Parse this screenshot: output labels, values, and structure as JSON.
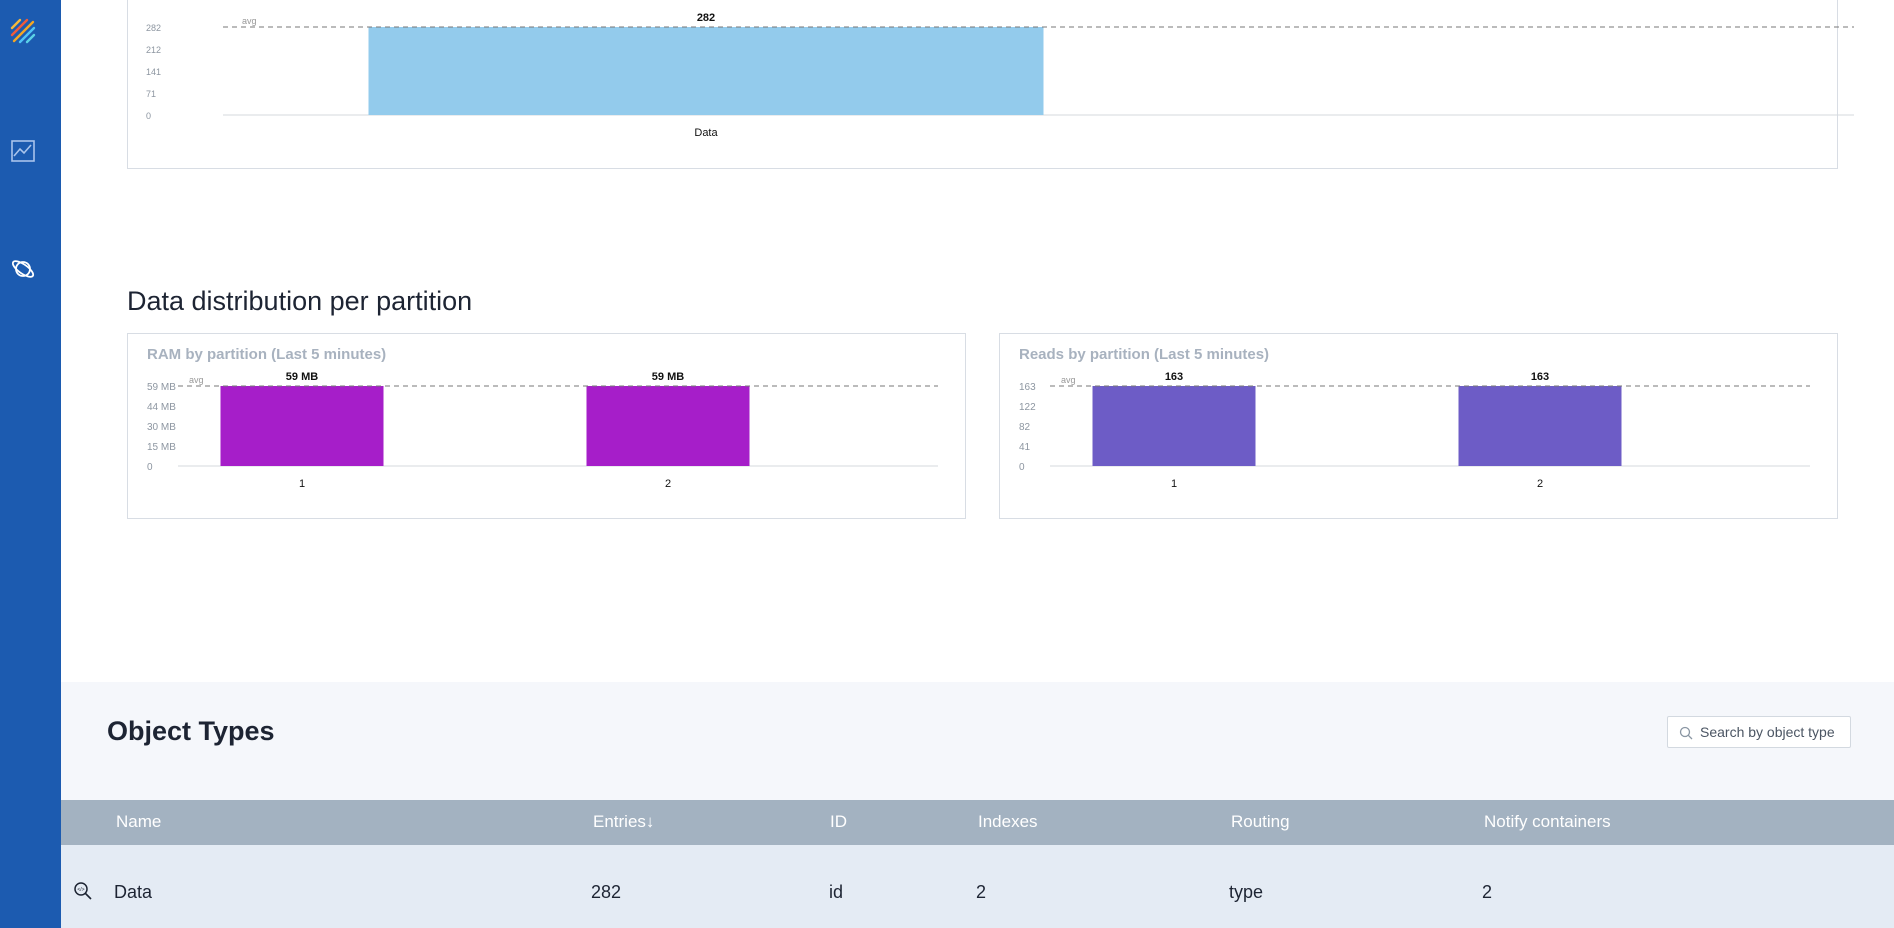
{
  "sidebar": {
    "items": [
      {
        "icon": "logo-icon"
      },
      {
        "icon": "chart-icon"
      },
      {
        "icon": "planet-icon"
      }
    ]
  },
  "top_chart": {
    "chart_data": {
      "type": "bar",
      "categories": [
        "Data"
      ],
      "values": [
        282
      ],
      "value_labels": [
        "282"
      ],
      "yticks": [
        "0",
        "71",
        "141",
        "212",
        "282"
      ],
      "ylim": [
        0,
        282
      ],
      "avg_label": "avg",
      "avg": 282,
      "color": "#93cbec"
    }
  },
  "distribution": {
    "title": "Data distribution per partition",
    "ram_chart": {
      "title": "RAM by partition (Last 5 minutes)",
      "chart_data": {
        "type": "bar",
        "categories": [
          "1",
          "2"
        ],
        "values": [
          59,
          59
        ],
        "value_labels": [
          "59 MB",
          "59 MB"
        ],
        "yticks": [
          "0",
          "15 MB",
          "30 MB",
          "44 MB",
          "59 MB"
        ],
        "ylim": [
          0,
          59
        ],
        "avg_label": "avg",
        "avg": 59,
        "color": "#a61ec9"
      }
    },
    "reads_chart": {
      "title": "Reads by partition (Last 5 minutes)",
      "chart_data": {
        "type": "bar",
        "categories": [
          "1",
          "2"
        ],
        "values": [
          163,
          163
        ],
        "value_labels": [
          "163",
          "163"
        ],
        "yticks": [
          "0",
          "41",
          "82",
          "122",
          "163"
        ],
        "ylim": [
          0,
          163
        ],
        "avg_label": "avg",
        "avg": 163,
        "color": "#6d5cc6"
      }
    }
  },
  "object_types": {
    "title": "Object Types",
    "search": {
      "placeholder": "Search by object type",
      "value": ""
    },
    "columns": [
      "Name",
      "Entries↓",
      "ID",
      "Indexes",
      "Routing",
      "Notify containers"
    ],
    "rows": [
      {
        "icon": "inspect-icon",
        "cells": [
          "Data",
          "282",
          "id",
          "2",
          "type",
          "2"
        ]
      }
    ]
  }
}
